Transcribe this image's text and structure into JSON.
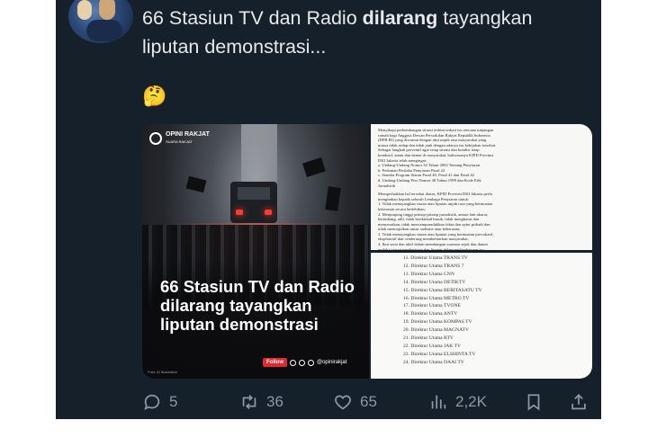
{
  "tweet": {
    "text_before": "66 Stasiun TV dan Radio ",
    "text_bold": "dilarang",
    "text_after": " tayangkan liputan demonstrasi...",
    "emoji": "🤔"
  },
  "media": {
    "poster": {
      "logo_name": "OPINI RAKJAT",
      "logo_tagline": "SUARA RAKJAT",
      "headline": "66 Stasiun TV dan Radio dilarang tayangkan liputan demonstrasi",
      "follow_label": "Follow",
      "handle": "@opinirakjat",
      "credit": "Foto: AI illustration"
    },
    "document_top": {
      "lines": [
        "Menyikapi perkembangan situasi terkini terkait isu rencana tunjangan",
        "rumah bagi Anggota Dewan Perwakilan Rakyat Republik Indonesia",
        "(DPR RI) yang diwarnai dengan aksi unjuk rasa masyarakat yang",
        "massa tidak sedap dan tidak jauh dengan adanya isu kebijakan tersebut.",
        "Sebagai langkah preventif agar tetap situasi dan kondisi tetap",
        "kondusif, aman dan damai di masyarakat, bahwasanya KPID Provinsi",
        "DKI Jakarta telah mengingat:",
        "a.  Undang-Undang Nomor 32 Tahun 2002 Tentang Penyiaran",
        "b.  Pedoman Perilaku Penyiaran Pasal 22",
        "c.  Standar Program Siaran Pasal 40, Pasal 41 dan Pasal 42",
        "d.  Undang-Undang Pers Nomor 40 Tahun 1999 dan Kode Etik",
        "     Jurnalistik",
        "",
        "Memperhatikan hal tersebut diatas, KPID Provinsi DKI Jakarta perlu",
        "mengimbau kepada seluruh Lembaga Penyiaran untuk:",
        "1.  Tidak menayangkan siaran atau liputan unjuk rasa yang bermuatan",
        "     kekerasan secara berlebihan;",
        "2.  Menjunjung tinggi prinsip-prinsip jurnalistik, antara lain akurat,",
        "     berimbang, adil, tidak beriktikad buruk, tidak menghasut dan",
        "     menyesatkan, tidak mencampuradukkan fakta dan opini pribadi dan",
        "     tidak menonjolkan unsur sadisme atau kekerasan;",
        "3.  Tidak menayangkan siaran atau liputan yang bermuatan provokatif,",
        "     eksploitatif dan cenderung membenturkan masyarakat;",
        "4.  Ikut serta dan aktif dalam membangun suasana sejuk dan damai",
        "     melalui siaran pemberitaan dan liputan dalam perlombangan isu"
      ]
    },
    "document_bottom": {
      "rows": [
        "11. Direktur Utama TRANS TV",
        "12. Direktur Utama TRANS 7",
        "13. Direktur Utama CNN",
        "14. Direktur Utama DETIKTV",
        "15. Direktur Utama BERITASATU TV",
        "16. Direktur Utama METRO TV",
        "17. Direktur Utama TVONE",
        "18. Direktur Utama ANTV",
        "19. Direktur Utama KOMPAS TV",
        "20. Direktur Utama MAGNATV",
        "21. Direktur Utama RTV",
        "22. Direktur Utama JAK TV",
        "23. Direktur Utama ELSHINTA TV",
        "24. Direktur Utama DAAI TV"
      ]
    }
  },
  "actions": {
    "replies": "5",
    "reposts": "36",
    "likes": "65",
    "views": "2,2K"
  },
  "colors": {
    "tweet_bg": "#15202b",
    "text": "#e7e9ea",
    "icon_gray": "#8b98a5",
    "follow_red": "#e0282e"
  }
}
